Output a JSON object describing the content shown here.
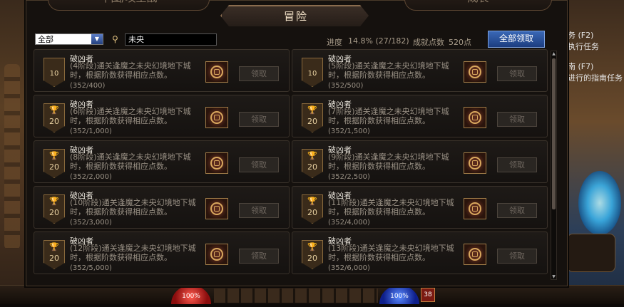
{
  "window": {
    "left_tab": "牟图/攻坚战",
    "right_tab": "成长",
    "title": "冒险"
  },
  "toolbar": {
    "filter_value": "全部",
    "search_value": "未央",
    "progress_label": "进度",
    "progress_value": "14.8% (27/182)",
    "points_label": "成就点数",
    "points_value": "520点",
    "claim_all_label": "全部领取"
  },
  "cards": [
    {
      "title": "破凶者",
      "stage": "(4阶段)",
      "desc": "通关逢魔之未央幻境地下城时，根据阶数获得相应点数。",
      "progress": "(352/400)",
      "points": "10",
      "trophy": false,
      "claim": "领取"
    },
    {
      "title": "破凶者",
      "stage": "(5阶段)",
      "desc": "通关逢魔之未央幻境地下城时，根据阶数获得相应点数。",
      "progress": "(352/500)",
      "points": "10",
      "trophy": false,
      "claim": "领取"
    },
    {
      "title": "破凶者",
      "stage": "(6阶段)",
      "desc": "通关逢魔之未央幻境地下城时，根据阶数获得相应点数。",
      "progress": "(352/1,000)",
      "points": "20",
      "trophy": true,
      "claim": "领取"
    },
    {
      "title": "破凶者",
      "stage": "(7阶段)",
      "desc": "通关逢魔之未央幻境地下城时，根据阶数获得相应点数。",
      "progress": "(352/1,500)",
      "points": "20",
      "trophy": true,
      "claim": "领取"
    },
    {
      "title": "破凶者",
      "stage": "(8阶段)",
      "desc": "通关逢魔之未央幻境地下城时，根据阶数获得相应点数。",
      "progress": "(352/2,000)",
      "points": "20",
      "trophy": true,
      "claim": "领取"
    },
    {
      "title": "破凶者",
      "stage": "(9阶段)",
      "desc": "通关逢魔之未央幻境地下城时，根据阶数获得相应点数。",
      "progress": "(352/2,500)",
      "points": "20",
      "trophy": true,
      "claim": "领取"
    },
    {
      "title": "破凶者",
      "stage": "(10阶段)",
      "desc": "通关逢魔之未央幻境地下城时，根据阶数获得相应点数。",
      "progress": "(352/3,000)",
      "points": "20",
      "trophy": true,
      "claim": "领取"
    },
    {
      "title": "破凶者",
      "stage": "(11阶段)",
      "desc": "通关逢魔之未央幻境地下城时，根据阶数获得相应点数。",
      "progress": "(352/4,000)",
      "points": "20",
      "trophy": true,
      "claim": "领取"
    },
    {
      "title": "破凶者",
      "stage": "(12阶段)",
      "desc": "通关逢魔之未央幻境地下城时，根据阶数获得相应点数。",
      "progress": "(352/5,000)",
      "points": "20",
      "trophy": true,
      "claim": "领取"
    },
    {
      "title": "破凶者",
      "stage": "(13阶段)",
      "desc": "通关逢魔之未央幻境地下城时，根据阶数获得相应点数。",
      "progress": "(352/6,000)",
      "points": "20",
      "trophy": true,
      "claim": "领取"
    }
  ],
  "side_quests": [
    {
      "text": "务 (F2)"
    },
    {
      "text": "执行任务"
    },
    {
      "text": "南 (F7)"
    },
    {
      "text": "进行的指南任务"
    }
  ],
  "hud": {
    "hp": "100%",
    "mp": "100%",
    "level": "38"
  }
}
